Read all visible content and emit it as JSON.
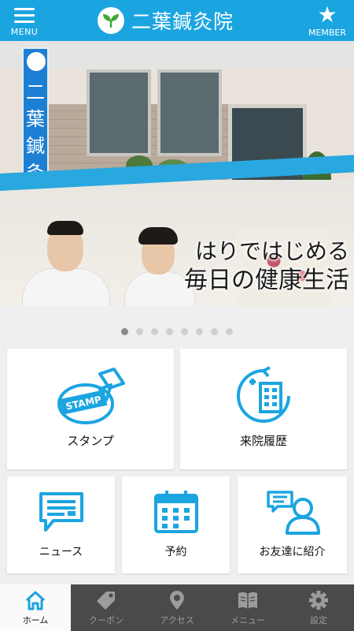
{
  "header": {
    "menu_label": "MENU",
    "title": "二葉鍼灸院",
    "member_label": "MEMBER"
  },
  "hero": {
    "sign_text": "二葉鍼灸院",
    "tagline_line1": "はりではじめる",
    "tagline_line2": "毎日の健康生活"
  },
  "carousel": {
    "count": 8,
    "active_index": 0
  },
  "tiles": {
    "stamp_label": "スタンプ",
    "stamp_badge": "STAMP",
    "history_label": "来院履歴",
    "news_label": "ニュース",
    "reservation_label": "予約",
    "refer_label": "お友達に紹介"
  },
  "tabbar": {
    "home": "ホーム",
    "coupon": "クーポン",
    "access": "アクセス",
    "menu": "メニュー",
    "settings": "設定"
  },
  "colors": {
    "brand": "#1ba5e0",
    "icon": "#1ba5e0",
    "tabbar_bg": "#4a4a4a",
    "page_bg": "#efefef"
  }
}
